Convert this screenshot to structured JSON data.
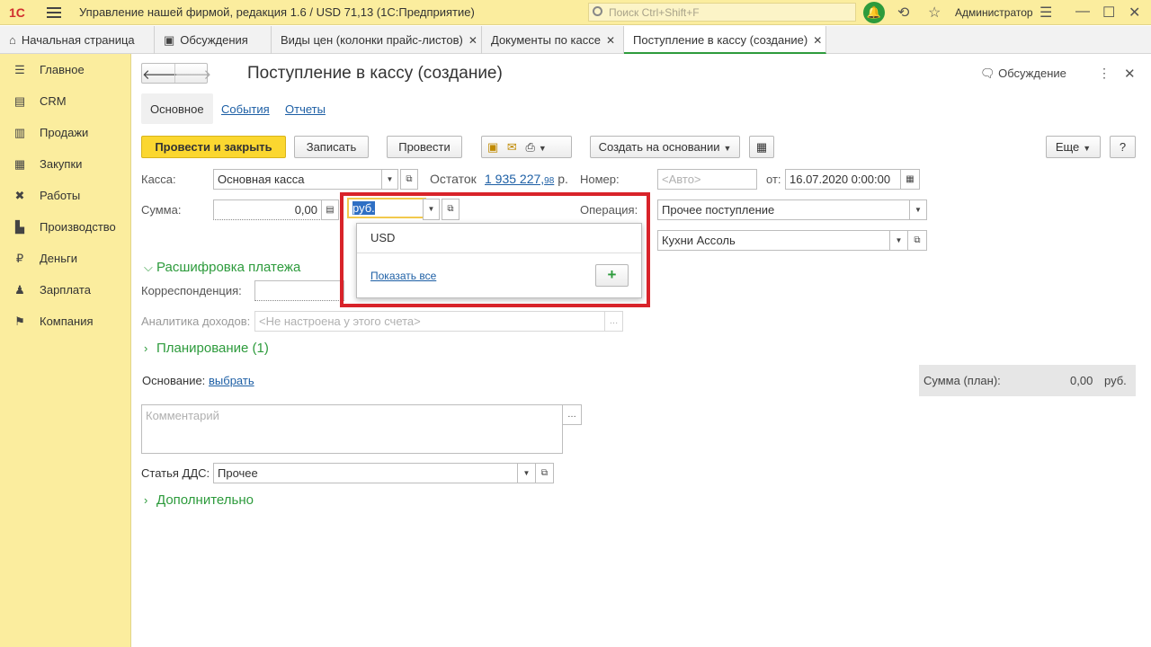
{
  "titlebar": {
    "logo": "1С",
    "app_title": "Управление нашей фирмой, редакция 1.6 / USD 71,13  (1С:Предприятие)",
    "search_placeholder": "Поиск Ctrl+Shift+F",
    "user": "Администратор"
  },
  "tabs": [
    {
      "label": "Начальная страница",
      "icon": "home-icon"
    },
    {
      "label": "Обсуждения",
      "icon": "chat-icon"
    },
    {
      "label": "Виды цен (колонки прайс-листов)",
      "close": "✕"
    },
    {
      "label": "Документы по кассе",
      "close": "✕"
    },
    {
      "label": "Поступление в кассу (создание)",
      "close": "✕"
    }
  ],
  "sidebar": {
    "items": [
      {
        "label": "Главное",
        "icon": "list-icon"
      },
      {
        "label": "CRM",
        "icon": "contacts-icon"
      },
      {
        "label": "Продажи",
        "icon": "shop-icon"
      },
      {
        "label": "Закупки",
        "icon": "cart-icon"
      },
      {
        "label": "Работы",
        "icon": "tools-icon"
      },
      {
        "label": "Производство",
        "icon": "factory-icon"
      },
      {
        "label": "Деньги",
        "icon": "ruble-icon"
      },
      {
        "label": "Зарплата",
        "icon": "people-icon"
      },
      {
        "label": "Компания",
        "icon": "flag-icon"
      }
    ]
  },
  "form": {
    "title": "Поступление в кассу (создание)",
    "discussion": "Обсуждение",
    "section_tabs": {
      "main": "Основное",
      "events": "События",
      "reports": "Отчеты"
    },
    "toolbar": {
      "post_close": "Провести и закрыть",
      "save": "Записать",
      "post": "Провести",
      "create_based": "Создать на основании",
      "more": "Еще",
      "help": "?"
    },
    "fields": {
      "kassa_label": "Касса:",
      "kassa_value": "Основная касса",
      "balance_label": "Остаток",
      "balance_value": "1 935 227,",
      "balance_kop": "98",
      "balance_unit": "р.",
      "number_label": "Номер:",
      "number_placeholder": "<Авто>",
      "date_label": "от:",
      "date_value": "16.07.2020  0:00:00",
      "sum_label": "Сумма:",
      "sum_value": "0,00",
      "currency_value": "руб.",
      "operation_label": "Операция:",
      "operation_value": "Прочее поступление",
      "counterparty_value": "Кухни Ассоль",
      "corr_label": "Корреспонденция:",
      "analytics_label": "Аналитика доходов:",
      "analytics_placeholder": "<Не настроена у этого счета>",
      "basis_label": "Основание:",
      "basis_link": "выбрать",
      "plan_label": "Сумма (план):",
      "plan_value": "0,00",
      "plan_unit": "руб.",
      "comment_placeholder": "Комментарий",
      "dds_label": "Статья ДДС:",
      "dds_value": "Прочее"
    },
    "sections": {
      "payment": "Расшифровка платежа",
      "planning": "Планирование (1)",
      "additional": "Дополнительно"
    }
  },
  "popup": {
    "option": "USD",
    "show_all": "Показать все",
    "add": "+"
  },
  "colors": {
    "accent_green": "#2d9b3c",
    "highlight_red": "#d8232a",
    "primary_yellow": "#fbd730",
    "sidebar_bg": "#fbed9e"
  }
}
